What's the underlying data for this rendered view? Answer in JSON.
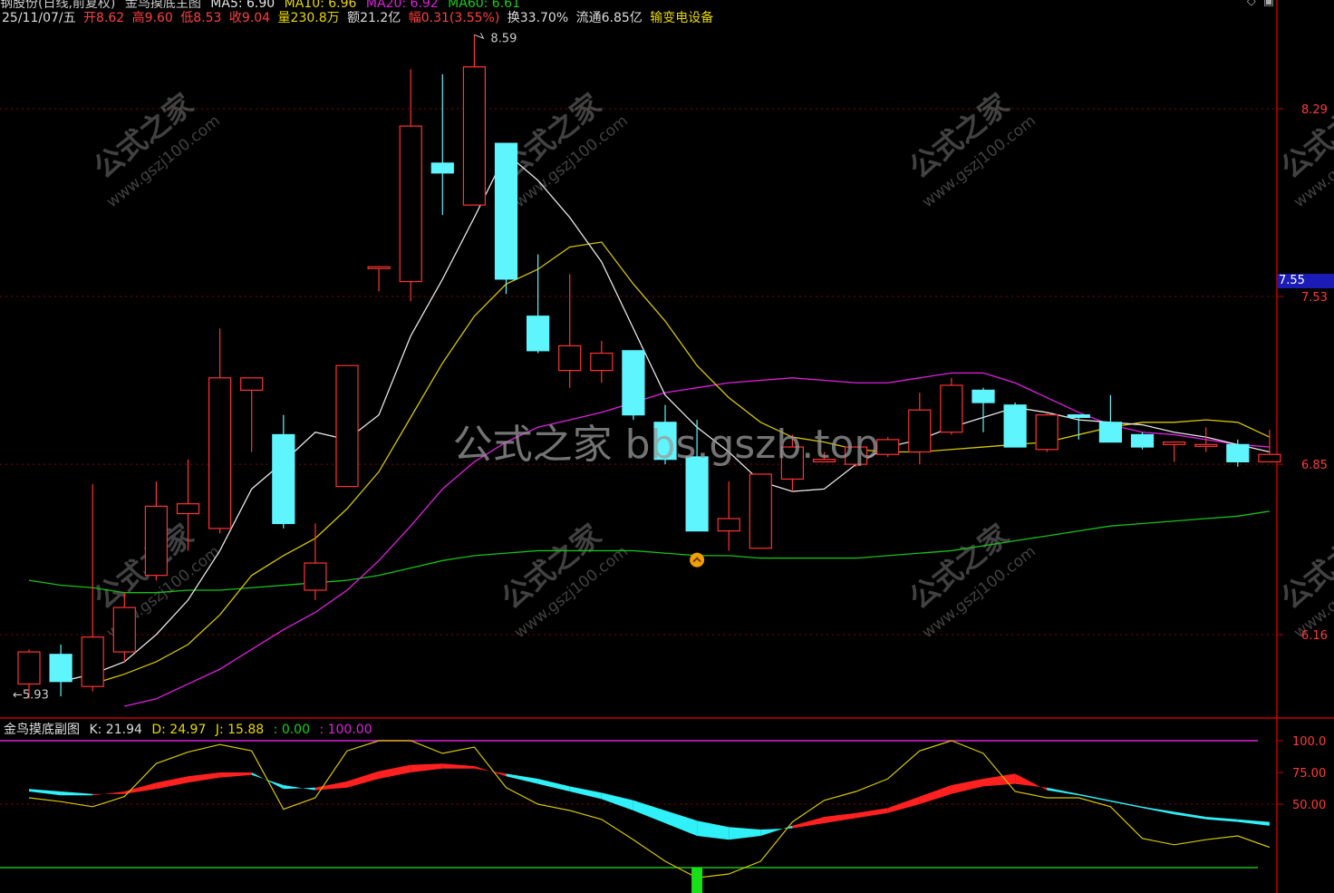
{
  "header_top": {
    "stock_name": "钢股份(日线,前复权)",
    "indicator_name": "金鸟摸底主图",
    "ma5": "MA5: 6.90",
    "ma10": "MA10: 6.96",
    "ma20": "MA20: 6.92",
    "ma60": "MA60: 6.61"
  },
  "header": {
    "date": "25/11/07/五",
    "open": "开8.62",
    "high": "高9.60",
    "low": "低8.53",
    "close": "收9.04",
    "volume": "量230.8万",
    "amount": "额21.2亿",
    "change": "幅0.31(3.55%)",
    "turnover": "换33.70%",
    "float": "流通6.85亿",
    "sector": "输变电设备"
  },
  "sub_header": {
    "name": "金鸟摸底副图",
    "k": "K: 21.94",
    "d": "D: 24.97",
    "j": "J: 15.88",
    "v0": ": 0.00",
    "v100": ": 100.00"
  },
  "price_tag": "7.55",
  "watermark": "公式之家 bbs.gszb.top",
  "watermark_tile": {
    "cn": "公式之家",
    "url": "www.gszj100.com"
  },
  "colors": {
    "up": "#ff3333",
    "down": "#5ff5ff",
    "ma5": "#e6e6e6",
    "ma10": "#d6c600",
    "ma20": "#e020e0",
    "ma60": "#18c018",
    "grid": "#8b0000",
    "axis": "#c00000"
  },
  "chart_data": [
    {
      "type": "candlestick",
      "y_ticks": [
        "8.29",
        "7.53",
        "6.85",
        "6.16"
      ],
      "annotations": {
        "high_label": "8.59",
        "low_label": "5.93"
      },
      "ohlc": [
        [
          5.96,
          6.1,
          5.9,
          6.09
        ],
        [
          6.08,
          6.12,
          5.91,
          5.97
        ],
        [
          5.95,
          6.77,
          5.93,
          6.15
        ],
        [
          6.09,
          6.33,
          6.05,
          6.27
        ],
        [
          6.4,
          6.78,
          6.38,
          6.68
        ],
        [
          6.65,
          6.87,
          6.5,
          6.69
        ],
        [
          6.59,
          7.4,
          6.57,
          7.2
        ],
        [
          7.15,
          7.2,
          6.9,
          7.2
        ],
        [
          6.97,
          7.05,
          6.59,
          6.61
        ],
        [
          6.34,
          6.61,
          6.3,
          6.45
        ],
        [
          6.76,
          7.22,
          6.76,
          7.25
        ],
        [
          7.65,
          7.55,
          7.55,
          7.65
        ],
        [
          7.59,
          8.45,
          7.51,
          8.22
        ],
        [
          8.07,
          8.43,
          7.86,
          8.03
        ],
        [
          7.9,
          8.59,
          7.9,
          8.46
        ],
        [
          8.15,
          8.15,
          7.54,
          7.6
        ],
        [
          7.45,
          7.7,
          7.3,
          7.31
        ],
        [
          7.23,
          7.62,
          7.16,
          7.33
        ],
        [
          7.23,
          7.35,
          7.18,
          7.3
        ],
        [
          7.31,
          7.3,
          7.03,
          7.05
        ],
        [
          7.02,
          7.09,
          6.85,
          6.87
        ],
        [
          6.88,
          7.03,
          6.58,
          6.58
        ],
        [
          6.58,
          6.78,
          6.5,
          6.63
        ],
        [
          6.51,
          6.81,
          6.51,
          6.81
        ],
        [
          6.79,
          6.97,
          6.74,
          6.92
        ],
        [
          6.86,
          6.9,
          6.86,
          6.87
        ],
        [
          6.85,
          6.9,
          6.84,
          6.92
        ],
        [
          6.89,
          6.96,
          6.88,
          6.95
        ],
        [
          6.9,
          7.14,
          6.85,
          7.07
        ],
        [
          6.98,
          7.2,
          6.97,
          7.17
        ],
        [
          7.15,
          7.16,
          6.98,
          7.1
        ],
        [
          7.09,
          7.1,
          6.92,
          6.92
        ],
        [
          6.91,
          7.06,
          6.9,
          7.05
        ],
        [
          7.05,
          7.05,
          6.95,
          7.04
        ],
        [
          7.02,
          7.13,
          6.94,
          6.94
        ],
        [
          6.97,
          6.98,
          6.91,
          6.92
        ],
        [
          6.93,
          6.94,
          6.86,
          6.94
        ],
        [
          6.93,
          7.0,
          6.9,
          6.93
        ],
        [
          6.93,
          6.95,
          6.84,
          6.86
        ],
        [
          6.86,
          6.99,
          6.86,
          6.89
        ]
      ],
      "ma5": [
        null,
        5.97,
        6.0,
        6.05,
        6.16,
        6.3,
        6.5,
        6.75,
        6.86,
        6.98,
        6.95,
        7.05,
        7.37,
        7.6,
        7.85,
        8.11,
        8.0,
        7.85,
        7.67,
        7.4,
        7.13,
        7.0,
        6.9,
        6.78,
        6.74,
        6.75,
        6.85,
        6.92,
        6.95,
        7.0,
        7.04,
        7.08,
        7.06,
        7.03,
        7.02,
        7.01,
        6.98,
        6.96,
        6.93,
        6.9
      ],
      "ma10": [
        null,
        null,
        5.96,
        6.0,
        6.05,
        6.12,
        6.24,
        6.4,
        6.48,
        6.55,
        6.67,
        6.82,
        7.04,
        7.26,
        7.45,
        7.58,
        7.64,
        7.73,
        7.75,
        7.58,
        7.43,
        7.25,
        7.12,
        7.02,
        6.96,
        6.94,
        6.91,
        6.9,
        6.9,
        6.91,
        6.92,
        6.93,
        6.94,
        6.97,
        7.0,
        7.02,
        7.02,
        7.03,
        7.02,
        6.96
      ],
      "ma20": [
        null,
        null,
        null,
        5.87,
        5.9,
        5.96,
        6.02,
        6.1,
        6.18,
        6.25,
        6.34,
        6.46,
        6.6,
        6.75,
        6.86,
        6.94,
        7.0,
        7.03,
        7.06,
        7.1,
        7.14,
        7.16,
        7.18,
        7.19,
        7.2,
        7.19,
        7.18,
        7.18,
        7.2,
        7.22,
        7.22,
        7.18,
        7.12,
        7.06,
        7.01,
        6.98,
        6.97,
        6.95,
        6.93,
        6.92
      ],
      "ma60": [
        6.38,
        6.36,
        6.35,
        6.33,
        6.33,
        6.34,
        6.34,
        6.35,
        6.36,
        6.37,
        6.38,
        6.4,
        6.43,
        6.46,
        6.48,
        6.49,
        6.5,
        6.5,
        6.5,
        6.5,
        6.49,
        6.48,
        6.48,
        6.47,
        6.47,
        6.47,
        6.47,
        6.48,
        6.49,
        6.5,
        6.52,
        6.54,
        6.56,
        6.58,
        6.6,
        6.61,
        6.62,
        6.63,
        6.64,
        6.66
      ],
      "signal_marker_index": 21
    },
    {
      "type": "kdj",
      "y_ticks": [
        "100.0",
        "75.00",
        "50.00"
      ],
      "k": [
        60,
        57,
        57,
        60,
        67,
        72,
        75,
        75,
        62,
        63,
        68,
        76,
        81,
        82,
        80,
        72,
        66,
        60,
        54,
        45,
        35,
        25,
        22,
        25,
        33,
        40,
        43,
        47,
        56,
        65,
        70,
        74,
        61,
        57,
        52,
        47,
        42,
        38,
        36,
        33
      ],
      "d": [
        62,
        60,
        58,
        58,
        62,
        67,
        71,
        73,
        65,
        61,
        63,
        70,
        75,
        78,
        78,
        74,
        70,
        64,
        59,
        53,
        45,
        37,
        32,
        30,
        31,
        35,
        39,
        43,
        50,
        58,
        64,
        66,
        63,
        58,
        53,
        48,
        44,
        40,
        38,
        36
      ],
      "j": [
        55,
        52,
        48,
        56,
        82,
        91,
        97,
        92,
        46,
        55,
        92,
        100,
        100,
        90,
        95,
        63,
        50,
        45,
        38,
        22,
        5,
        -8,
        -5,
        5,
        36,
        53,
        60,
        70,
        92,
        100,
        90,
        60,
        55,
        55,
        48,
        23,
        18,
        22,
        25,
        16
      ],
      "ref_lines": [
        0,
        100
      ],
      "signal_bar_index": 21
    }
  ]
}
